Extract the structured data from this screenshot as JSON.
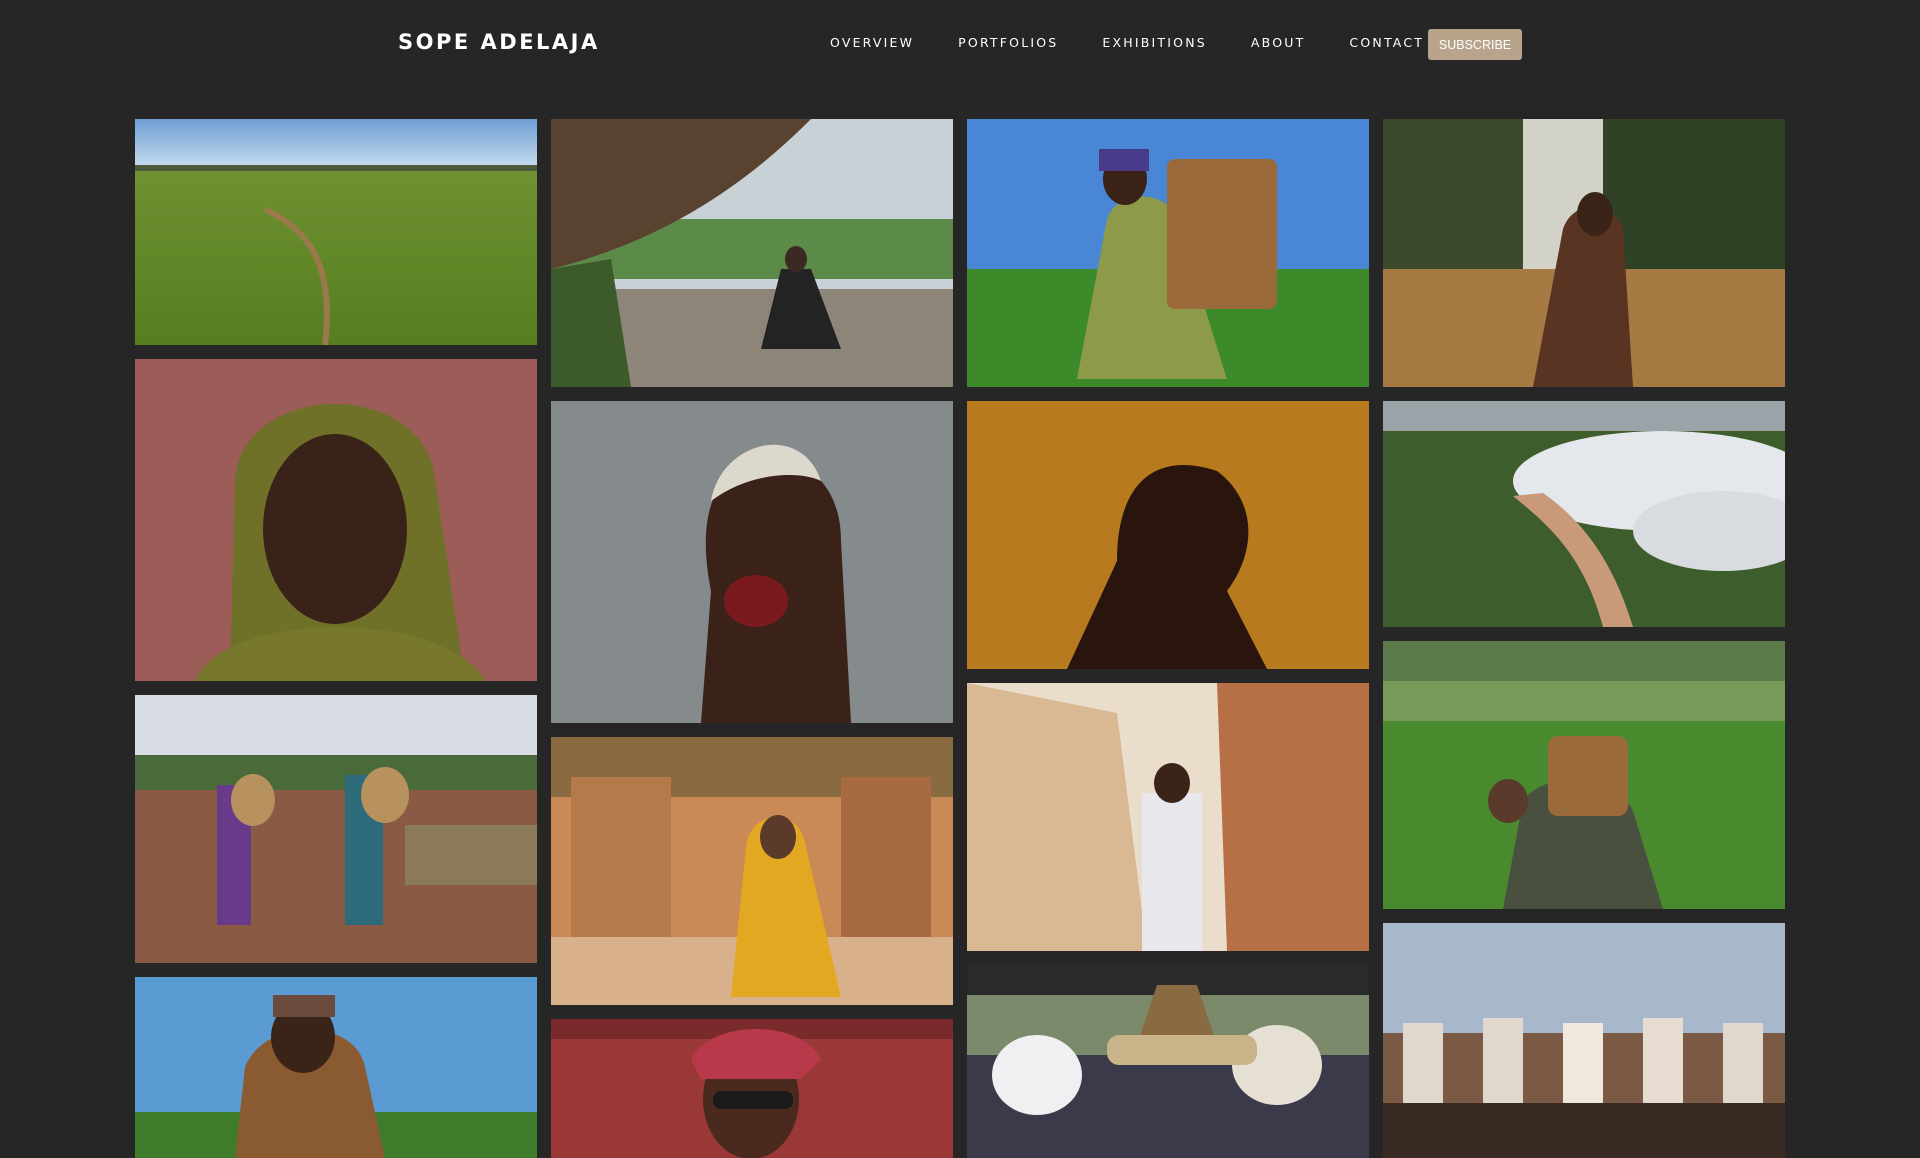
{
  "header": {
    "brand": "SOPE ADELAJA",
    "nav": [
      "OVERVIEW",
      "PORTFOLIOS",
      "EXHIBITIONS",
      "ABOUT",
      "CONTACT"
    ],
    "subscribe_label": "SUBSCRIBE"
  },
  "gallery": {
    "photos": [
      {
        "name": "photo-tea-field-aerial",
        "subject": "aerial view of green tea plantation"
      },
      {
        "name": "photo-man-sitting-under-rock",
        "subject": "man seated on rock overlooking valley"
      },
      {
        "name": "photo-woman-picking-tea-basket",
        "subject": "woman with basket picking tea leaves"
      },
      {
        "name": "photo-woman-in-tall-grass",
        "subject": "woman posing in golden grass"
      },
      {
        "name": "photo-portrait-green-hood",
        "subject": "portrait of woman in olive green headscarf"
      },
      {
        "name": "photo-profile-white-hair-rose",
        "subject": "profile of woman with bleached hair and red rose"
      },
      {
        "name": "photo-profile-golden-backdrop",
        "subject": "profile of woman against golden backdrop"
      },
      {
        "name": "photo-river-valley-mist",
        "subject": "aerial river valley with mist"
      },
      {
        "name": "photo-two-women-baskets",
        "subject": "two women walking with baskets on dirt path"
      },
      {
        "name": "photo-woman-yellow-hijab-hut",
        "subject": "woman in yellow hijab by mud hut"
      },
      {
        "name": "photo-old-man-mud-walls",
        "subject": "elderly man between mud walls"
      },
      {
        "name": "photo-man-tea-field-basket",
        "subject": "man bending in tea field with basket"
      },
      {
        "name": "photo-woman-picking-leaves",
        "subject": "woman in brown jacket picking leaves"
      },
      {
        "name": "photo-women-gele-sunglasses",
        "subject": "women in red gele and sunglasses"
      },
      {
        "name": "photo-festival-headdresses",
        "subject": "festival with ornate white headdresses"
      },
      {
        "name": "photo-horsemen-durbar",
        "subject": "horsemen at durbar festival"
      }
    ]
  },
  "colors": {
    "background": "#262626",
    "accent": "#b8a48a"
  }
}
